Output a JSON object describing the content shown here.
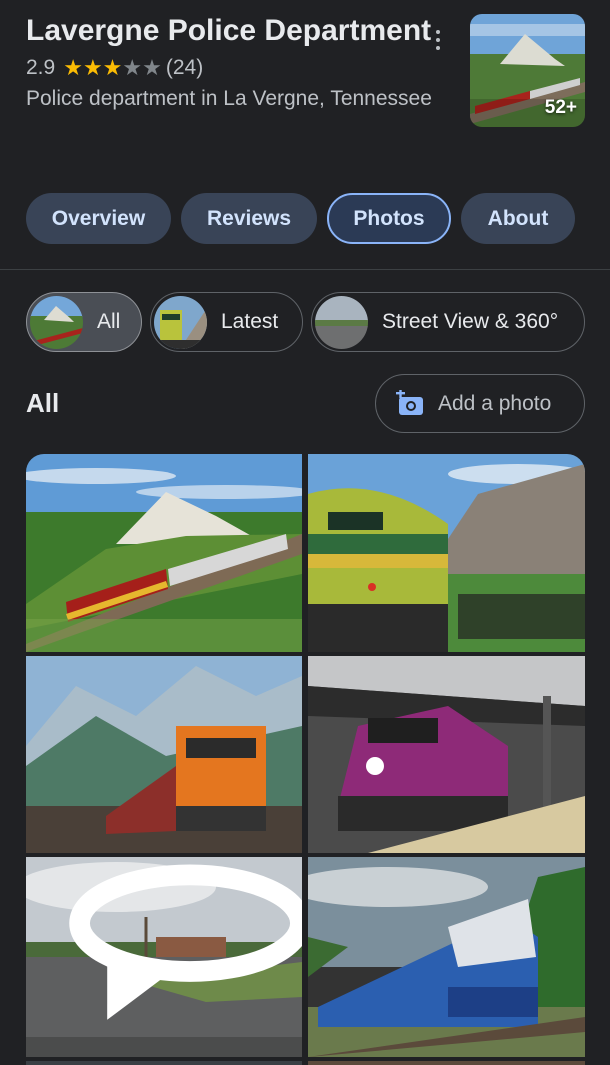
{
  "place": {
    "name": "Lavergne Police Department",
    "rating": "2.9",
    "stars_filled": 3,
    "stars_total": 5,
    "review_count": "(24)",
    "category": "Police department in La Vergne, Tennessee",
    "photo_count": "52+"
  },
  "tabs": [
    {
      "label": "Overview",
      "selected": false
    },
    {
      "label": "Reviews",
      "selected": false
    },
    {
      "label": "Photos",
      "selected": true
    },
    {
      "label": "About",
      "selected": false
    }
  ],
  "chips": [
    {
      "label": "All",
      "selected": true
    },
    {
      "label": "Latest",
      "selected": false
    },
    {
      "label": "Street View & 360°",
      "selected": false
    }
  ],
  "section": {
    "title": "All",
    "add_photo_label": "Add a photo"
  },
  "photos": [
    {
      "icon": "photo-red-train-hill"
    },
    {
      "icon": "photo-green-locomotive-6147"
    },
    {
      "icon": "photo-orange-freight-train"
    },
    {
      "icon": "photo-purple-commuter-train"
    },
    {
      "icon": "photo-street-view-parking-lot"
    },
    {
      "icon": "photo-blue-passenger-train"
    }
  ],
  "colors": {
    "background": "#202124",
    "tab_bg": "#394457",
    "tab_text": "#d2e3fc",
    "tab_selected_border": "#8ab4f8",
    "star_on": "#fbbc04",
    "star_off": "#80868b"
  },
  "icons": {
    "more": "more-vert-icon",
    "add_photo": "add-photo-icon",
    "street_view": "rotate-360-icon"
  }
}
